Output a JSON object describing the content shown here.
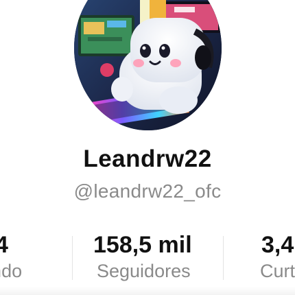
{
  "profile": {
    "display_name": "Leandrw22",
    "username": "@leandrw22_ofc",
    "avatar_icon": "marshmallow-gamer-avatar"
  },
  "stats": [
    {
      "value": "4",
      "label": "Seguindo"
    },
    {
      "value": "158,5 mil",
      "label": "Seguidores"
    },
    {
      "value": "3,4",
      "label": "Curtidas"
    }
  ],
  "colors": {
    "name_text": "#111111",
    "secondary_text": "#8a8a8a",
    "divider": "#e3e3e3"
  }
}
